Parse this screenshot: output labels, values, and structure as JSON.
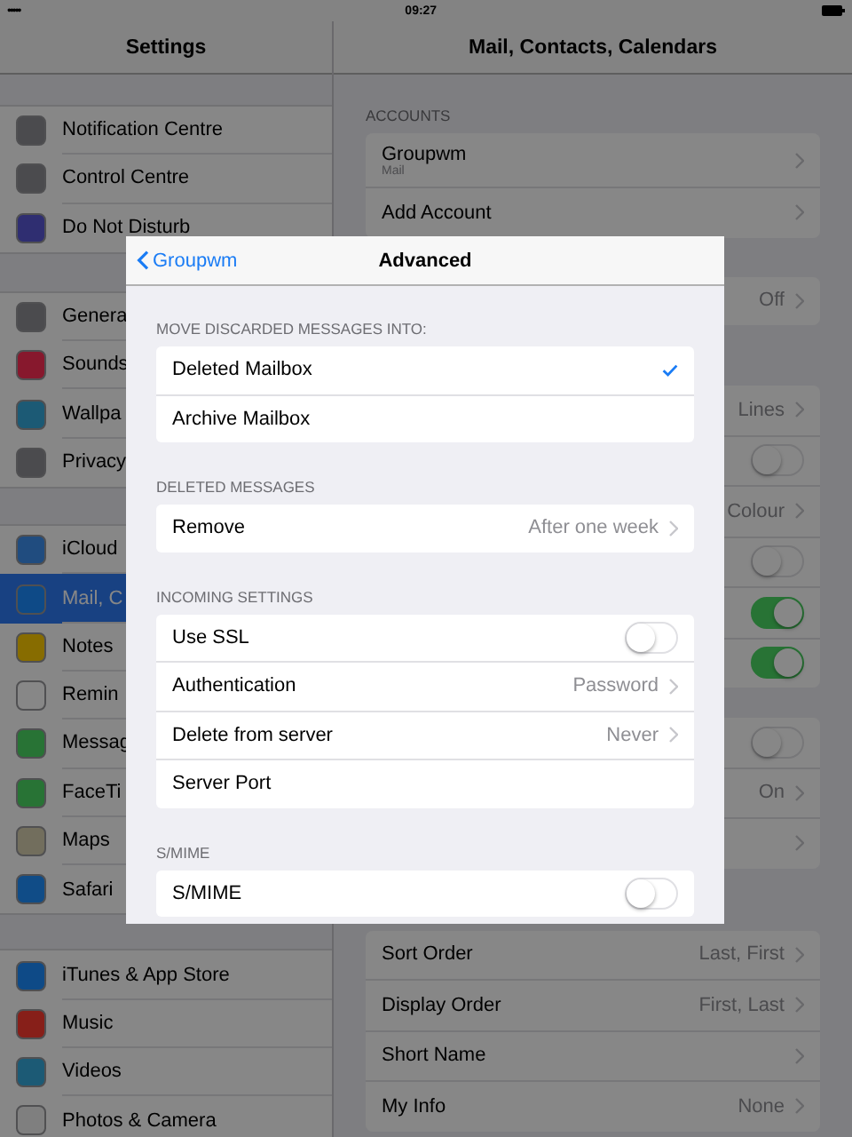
{
  "status_bar": {
    "signal": "•••••",
    "time": "09:27"
  },
  "sidebar": {
    "title": "Settings",
    "groups": [
      [
        {
          "label": "Notification Centre",
          "color": "#4b4b4e",
          "selected": false
        },
        {
          "label": "Control Centre",
          "color": "#4b4b4e",
          "selected": false
        },
        {
          "label": "Do Not Disturb",
          "color": "#2f2e71",
          "selected": false
        }
      ],
      [
        {
          "label": "Genera",
          "color": "#4b4b4e",
          "selected": false
        },
        {
          "label": "Sounds",
          "color": "#87182d",
          "selected": false
        },
        {
          "label": "Wallpa",
          "color": "#1c5a75",
          "selected": false
        },
        {
          "label": "Privacy",
          "color": "#4b4b4e",
          "selected": false
        }
      ],
      [
        {
          "label": "iCloud",
          "color": "#204c7f",
          "selected": false
        },
        {
          "label": "Mail, C",
          "color": "#0e4a87",
          "selected": true
        },
        {
          "label": "Notes",
          "color": "#876c00",
          "selected": false
        },
        {
          "label": "Remin",
          "color": "#878787",
          "selected": false
        },
        {
          "label": "Messag",
          "color": "#287335",
          "selected": false
        },
        {
          "label": "FaceTi",
          "color": "#287335",
          "selected": false
        },
        {
          "label": "Maps",
          "color": "#726e5d",
          "selected": false
        },
        {
          "label": "Safari",
          "color": "#104c87",
          "selected": false
        }
      ],
      [
        {
          "label": "iTunes & App Store",
          "color": "#0e4a87",
          "selected": false
        },
        {
          "label": "Music",
          "color": "#871f19",
          "selected": false
        },
        {
          "label": "Videos",
          "color": "#1c5a75",
          "selected": false
        },
        {
          "label": "Photos & Camera",
          "color": "#7f7f7f",
          "selected": false
        }
      ]
    ]
  },
  "detail": {
    "title": "Mail, Contacts, Calendars",
    "groups": [
      {
        "header": "ACCOUNTS",
        "rows": [
          {
            "kind": "link",
            "label": "Groupwm",
            "subtitle": "Mail"
          },
          {
            "kind": "link",
            "label": "Add Account"
          }
        ]
      },
      {
        "rows": [
          {
            "kind": "link",
            "value": "Off"
          }
        ]
      },
      {
        "rows": [
          {
            "kind": "link",
            "value": "Lines"
          },
          {
            "kind": "toggle",
            "on": false
          },
          {
            "kind": "link",
            "value": "Colour"
          },
          {
            "kind": "toggle",
            "on": false
          },
          {
            "kind": "toggle",
            "on": true
          },
          {
            "kind": "toggle",
            "on": true
          }
        ]
      },
      {
        "rows": [
          {
            "kind": "toggle",
            "on": false
          },
          {
            "kind": "link",
            "value": "On"
          },
          {
            "kind": "link"
          }
        ]
      },
      {
        "rows": [
          {
            "kind": "link",
            "label": "Sort Order",
            "value": "Last, First"
          },
          {
            "kind": "link",
            "label": "Display Order",
            "value": "First, Last"
          },
          {
            "kind": "link",
            "label": "Short Name"
          },
          {
            "kind": "link",
            "label": "My Info",
            "value": "None"
          }
        ]
      }
    ]
  },
  "modal": {
    "back": "Groupwm",
    "title": "Advanced",
    "sections": [
      {
        "header": "MOVE DISCARDED MESSAGES INTO:",
        "rows": [
          {
            "kind": "choice",
            "label": "Deleted Mailbox",
            "selected": true
          },
          {
            "kind": "choice",
            "label": "Archive Mailbox",
            "selected": false
          }
        ]
      },
      {
        "header": "DELETED MESSAGES",
        "rows": [
          {
            "kind": "link",
            "label": "Remove",
            "value": "After one week"
          }
        ]
      },
      {
        "header": "INCOMING SETTINGS",
        "rows": [
          {
            "kind": "toggle",
            "label": "Use SSL",
            "on": false
          },
          {
            "kind": "link",
            "label": "Authentication",
            "value": "Password"
          },
          {
            "kind": "link",
            "label": "Delete from server",
            "value": "Never"
          },
          {
            "kind": "field",
            "label": "Server Port"
          }
        ]
      },
      {
        "header": "S/MIME",
        "rows": [
          {
            "kind": "toggle",
            "label": "S/MIME",
            "on": false
          }
        ]
      }
    ]
  }
}
